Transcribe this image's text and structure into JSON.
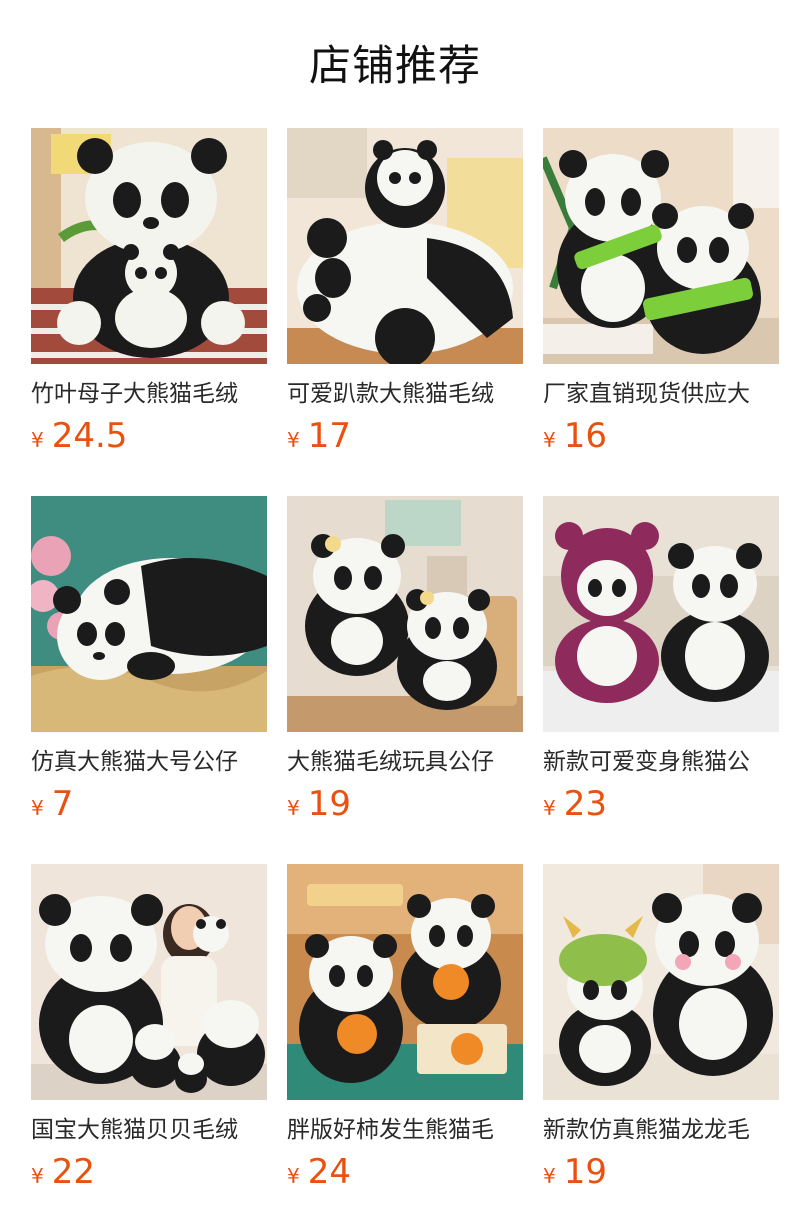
{
  "header": {
    "title": "店铺推荐"
  },
  "products": [
    {
      "name": "竹叶母子大熊猫毛绒",
      "currency": "¥",
      "price": "24.5",
      "image_icon": "panda-mother-and-cub-with-bamboo-icon",
      "bg": "#efe3d2",
      "floor": "#a24a3c"
    },
    {
      "name": "可爱趴款大熊猫毛绒",
      "currency": "¥",
      "price": "17",
      "image_icon": "lying-panda-with-cub-icon",
      "bg": "#f1e6d8",
      "floor": "#c78a52"
    },
    {
      "name": "厂家直销现货供应大",
      "currency": "¥",
      "price": "16",
      "image_icon": "two-pandas-holding-bamboo-icon",
      "bg": "#ecdcc8",
      "floor": "#d9c7b0"
    },
    {
      "name": "仿真大熊猫大号公仔",
      "currency": "¥",
      "price": "7",
      "image_icon": "lying-panda-on-straw-icon",
      "bg": "#3f8d80",
      "floor": "#c7a466"
    },
    {
      "name": "大熊猫毛绒玩具公仔",
      "currency": "¥",
      "price": "19",
      "image_icon": "two-pandas-with-flowers-icon",
      "bg": "#e7dcd0",
      "floor": "#c49a6c"
    },
    {
      "name": "新款可爱变身熊猫公",
      "currency": "¥",
      "price": "23",
      "image_icon": "panda-in-bear-costume-and-panda-icon",
      "bg": "#e9e1d6",
      "floor": "#eeeeee"
    },
    {
      "name": "国宝大熊猫贝贝毛绒",
      "currency": "¥",
      "price": "22",
      "image_icon": "panda-family-with-girl-icon",
      "bg": "#efe5da",
      "floor": "#dcd2c6"
    },
    {
      "name": "胖版好柿发生熊猫毛",
      "currency": "¥",
      "price": "24",
      "image_icon": "pandas-with-persimmons-icon",
      "bg": "#c98a4d",
      "floor": "#2f8a78"
    },
    {
      "name": "新款仿真熊猫龙龙毛",
      "currency": "¥",
      "price": "19",
      "image_icon": "panda-with-dragon-hat-icon",
      "bg": "#f1e8de",
      "floor": "#ebe2d6"
    }
  ],
  "colors": {
    "price": "#e8510e",
    "title": "#111111",
    "name": "#2a2a2a"
  }
}
